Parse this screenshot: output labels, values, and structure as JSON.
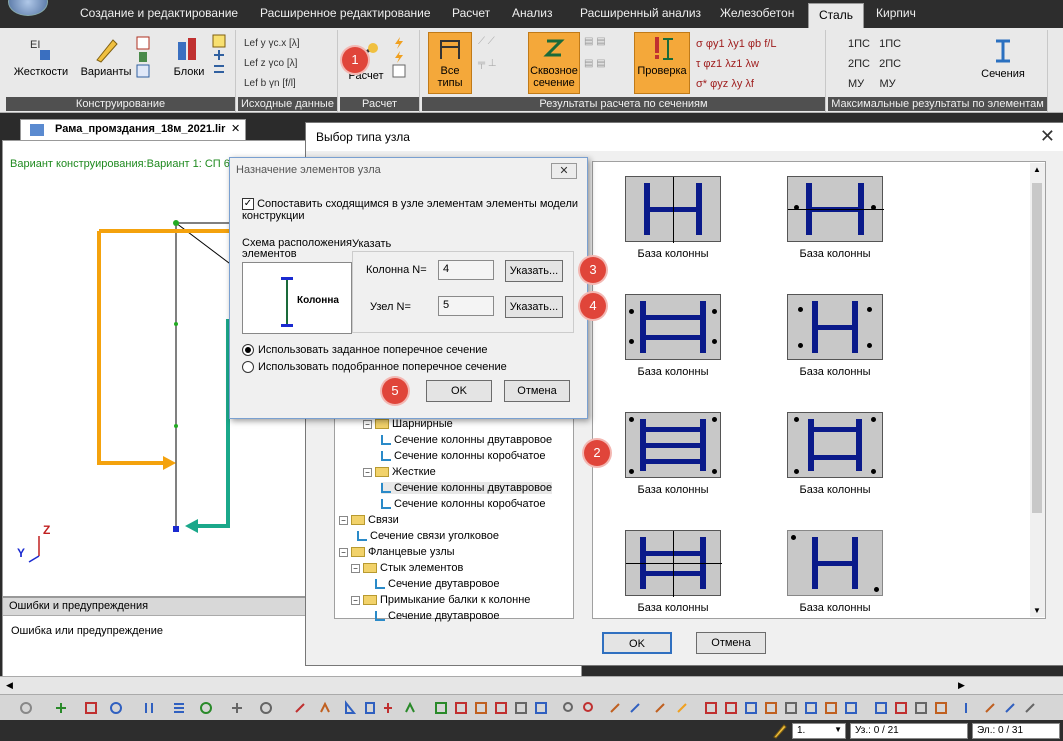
{
  "ribbon": {
    "tabs": [
      "Создание и редактирование",
      "Расширенное редактирование",
      "Расчет",
      "Анализ",
      "Расширенный анализ",
      "Железобетон",
      "Сталь",
      "Кирпич"
    ],
    "active_tab": "Сталь",
    "groups": {
      "konstr": {
        "caption": "Конструирование",
        "btn_stiff": "Жесткости",
        "btn_variants": "Варианты",
        "btn_blocks": "Блоки"
      },
      "ishod": {
        "caption": "Исходные данные",
        "items": [
          "Lef y",
          "γc.x",
          "[λ]",
          "Lef z",
          "γco",
          "[λ]",
          "Lef b",
          "γn",
          "[f/l]"
        ]
      },
      "raschet": {
        "caption": "Расчет",
        "btn": "Расчет"
      },
      "results": {
        "caption": "Результаты расчета по сечениям",
        "btn_all": "Все типы",
        "btn_through": "Сквозное сечение",
        "btn_check": "Проверка",
        "symbols": [
          "σ",
          "φy1",
          "λy1",
          "φb",
          "f/L",
          "τ",
          "φz1",
          "λz1",
          "λw",
          "σ*",
          "φyz",
          "λy",
          "λf"
        ]
      },
      "max": {
        "caption": "Максимальные результаты по элементам",
        "items": [
          "1ПС",
          "1ПС",
          "2ПС",
          "2ПС",
          "МУ",
          "МУ"
        ],
        "btn_sections": "Сечения"
      }
    },
    "accent": "#f4a83a"
  },
  "document": {
    "tab_title": "Рама_промздания_18м_2021.lir",
    "variant_text": "Вариант конструирования:Вариант 1: СП 6",
    "axis_z": "Z",
    "axis_y": "Y"
  },
  "errors": {
    "header": "Ошибки и предупреждения",
    "text": "Ошибка или предупреждение"
  },
  "main_dialog": {
    "title": "Выбор типа узла",
    "tree": [
      {
        "label": "Шарнирные",
        "kind": "folder",
        "level": 1
      },
      {
        "label": "Сечение колонны двутавровое",
        "kind": "leaf",
        "level": 2
      },
      {
        "label": "Сечение колонны коробчатое",
        "kind": "leaf",
        "level": 2
      },
      {
        "label": "Жесткие",
        "kind": "folder",
        "level": 1
      },
      {
        "label": "Сечение колонны двутавровое",
        "kind": "leaf",
        "level": 2
      },
      {
        "label": "Сечение колонны коробчатое",
        "kind": "leaf",
        "level": 2
      },
      {
        "label": "Связи",
        "kind": "folder",
        "level": 0
      },
      {
        "label": "Сечение связи уголковое",
        "kind": "leaf",
        "level": 1
      },
      {
        "label": "Фланцевые узлы",
        "kind": "folder",
        "level": 0
      },
      {
        "label": "Стык элементов",
        "kind": "folder",
        "level": 1
      },
      {
        "label": "Сечение двутавровое",
        "kind": "leaf",
        "level": 2
      },
      {
        "label": "Примыкание балки к колонне",
        "kind": "folder",
        "level": 1
      },
      {
        "label": "Сечение двутавровое",
        "kind": "leaf",
        "level": 2
      }
    ],
    "gallery": [
      "База колонны",
      "База колонны",
      "База колонны",
      "База колонны",
      "База колонны",
      "База колонны",
      "База колонны",
      "База колонны"
    ],
    "ok": "OK",
    "cancel": "Отмена"
  },
  "assign_dialog": {
    "title": "Назначение элементов узла",
    "checkbox_label": "Сопоставить сходящимся в узле элементам элементы модели конструкции",
    "checked": true,
    "scheme_label": "Схема расположения элементов",
    "scheme_item": "Колонна",
    "specify_group": "Указать",
    "column_label": "Колонна N=",
    "column_value": "4",
    "node_label": "Узел N=",
    "node_value": "5",
    "specify_btn": "Указать...",
    "radio_given": "Использовать заданное поперечное сечение",
    "radio_selected": "Использовать подобранное поперечное сечение",
    "ok": "OK",
    "cancel": "Отмена"
  },
  "markers": [
    "1",
    "2",
    "3",
    "4",
    "5"
  ],
  "status": {
    "field1": "1.",
    "nodes": "Уз.: 0 / 21",
    "elements": "Эл.: 0 / 31"
  },
  "colors": {
    "orange_arrow": "#f4a20d",
    "teal_arrow": "#1aa88a",
    "marker": "#e0453a"
  }
}
